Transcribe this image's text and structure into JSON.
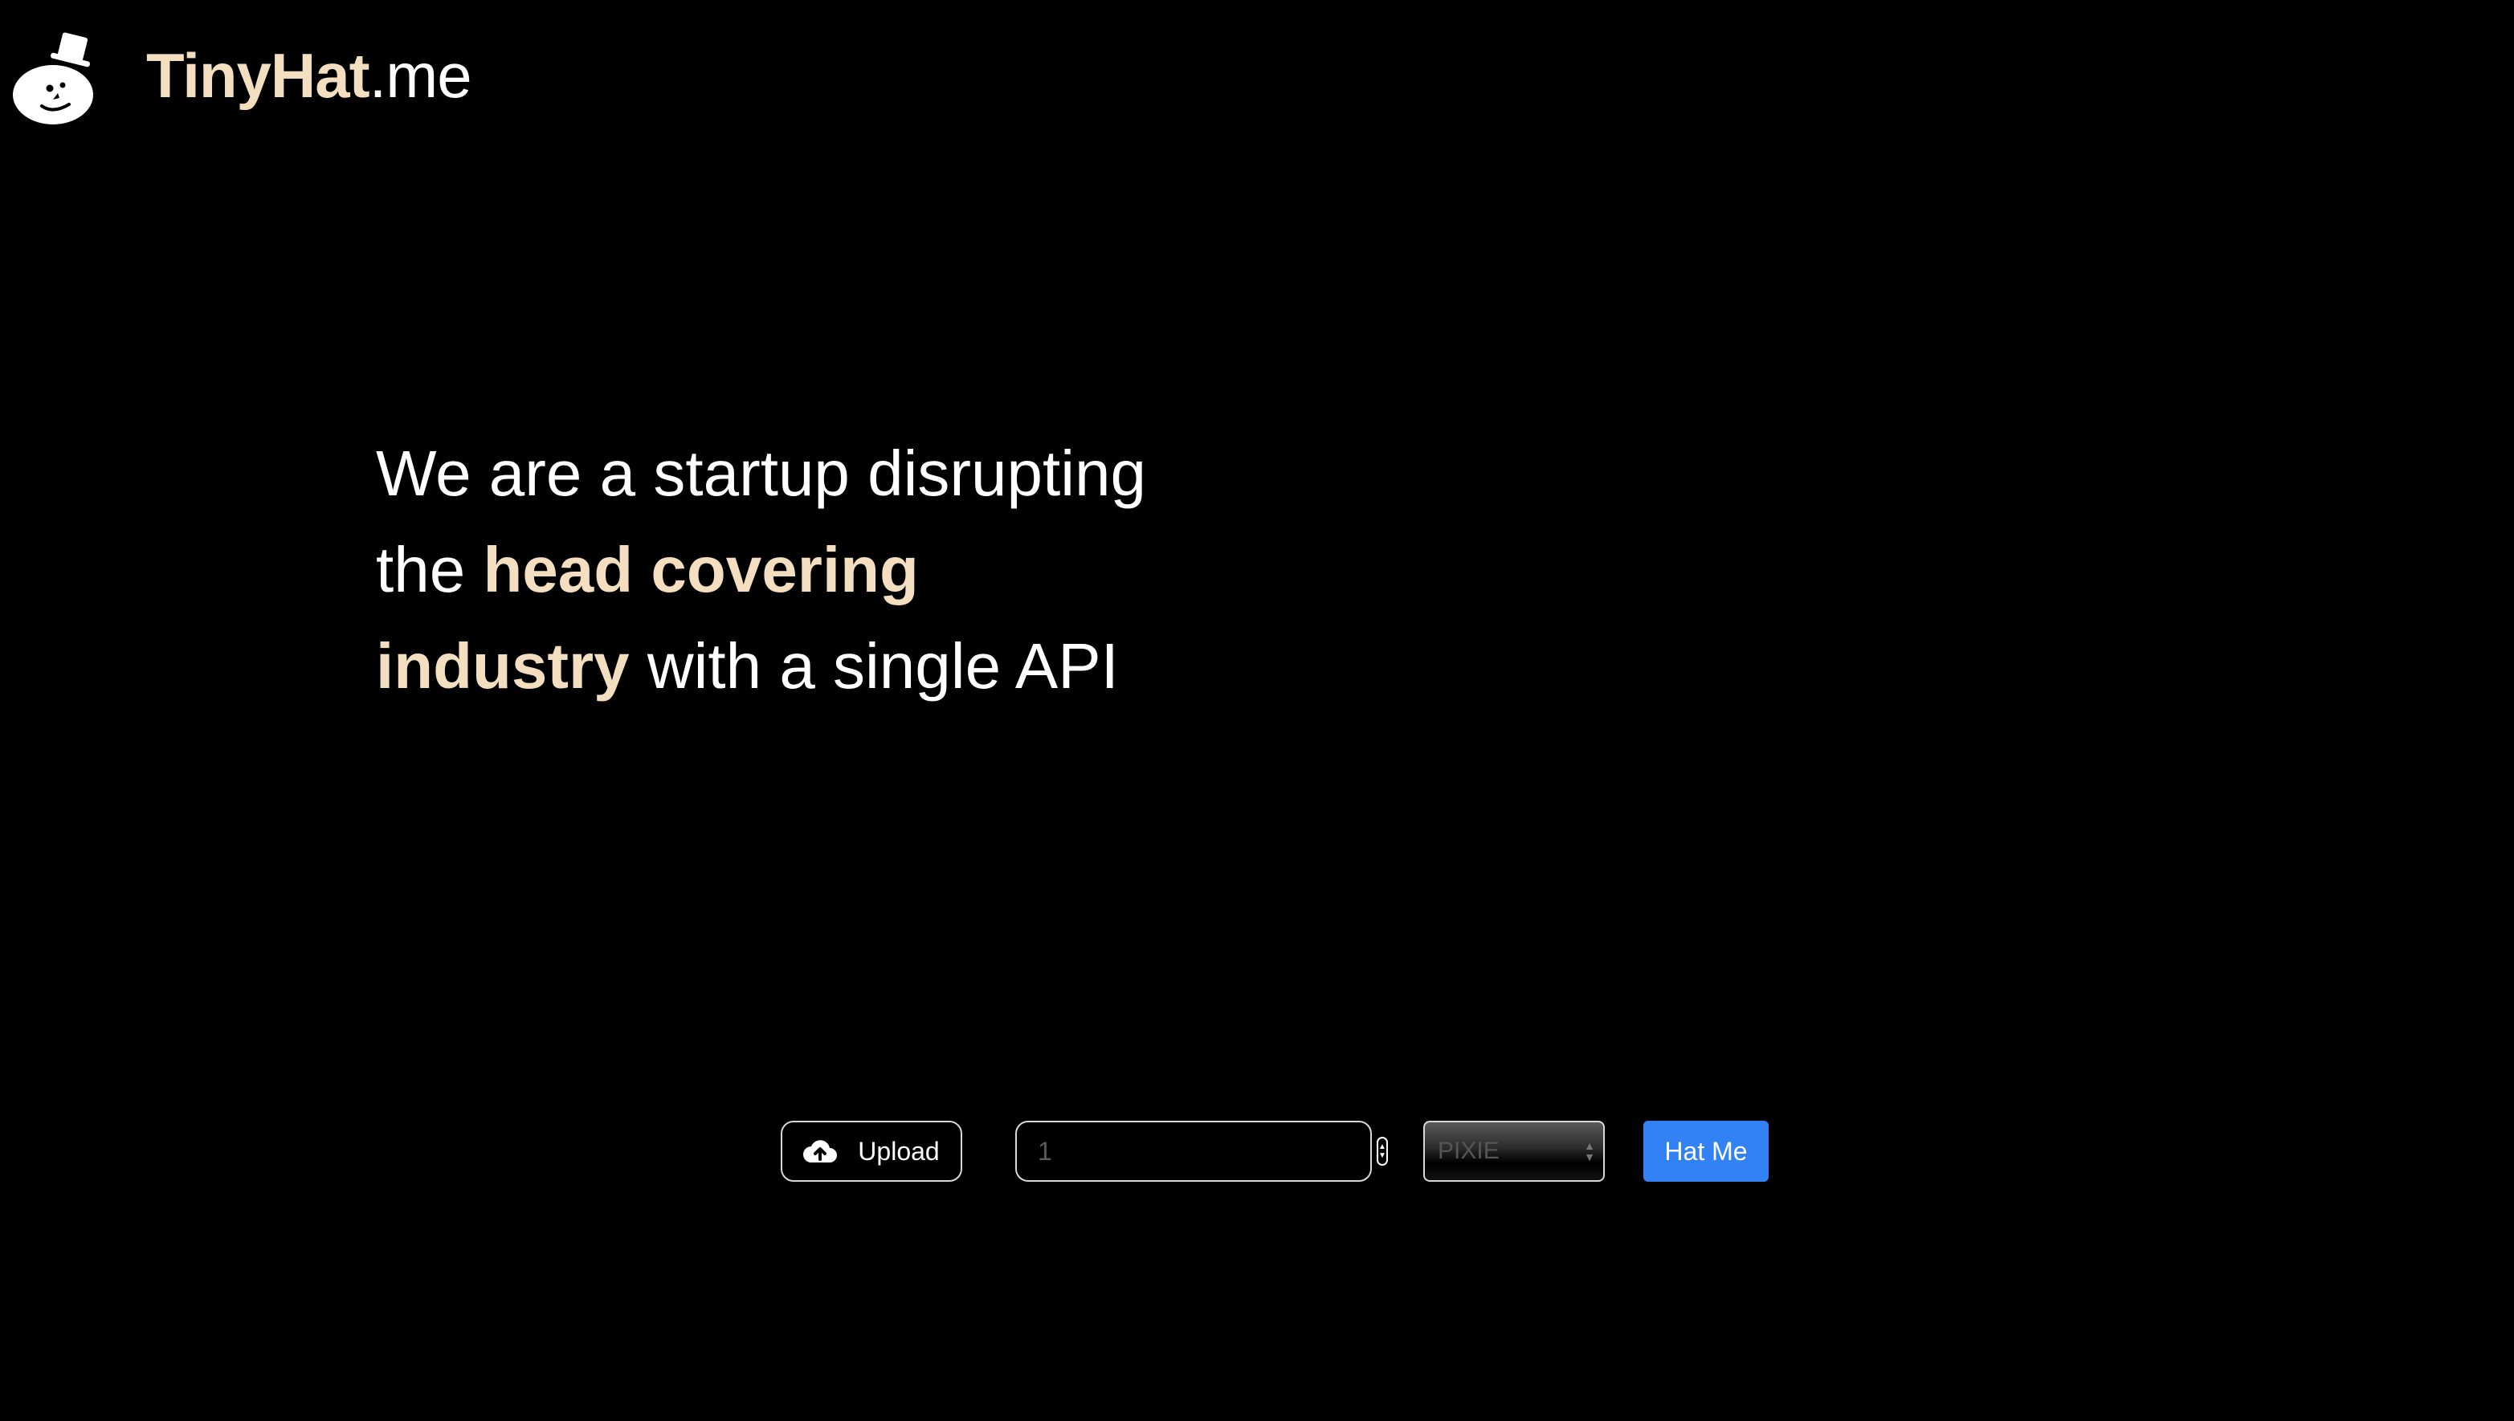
{
  "header": {
    "brand_main": "TinyHat",
    "brand_tld": ".me",
    "logo_icon": "snowman-top-hat-icon"
  },
  "hero": {
    "part1": "We are a startup disrupting the ",
    "accent1": "head covering industry",
    "part2": " with a single API"
  },
  "controls": {
    "upload_label": "Upload",
    "upload_icon": "cloud-upload-icon",
    "quantity_placeholder": "1",
    "style_selected": "PIXIE",
    "submit_label": "Hat Me"
  },
  "colors": {
    "background": "#000000",
    "accent": "#f3dfbf",
    "button_primary": "#3282f6"
  }
}
